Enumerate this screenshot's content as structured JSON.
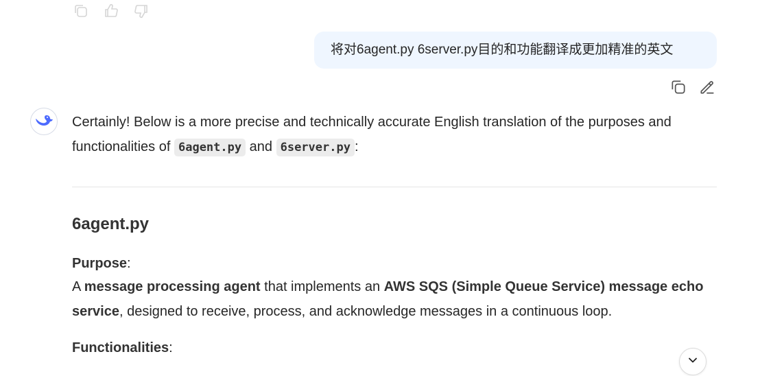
{
  "top_actions": {
    "icons": [
      "copy-icon",
      "thumbs-up-icon",
      "thumbs-down-icon"
    ]
  },
  "user_message": {
    "text": "将对6agent.py 6server.py目的和功能翻译成更加精准的英文",
    "actions": [
      "copy-icon",
      "edit-icon"
    ]
  },
  "assistant": {
    "avatar_icon": "whale-logo-icon",
    "intro": {
      "part1": "Certainly! Below is a more precise and technically accurate English translation of the purposes and functionalities of ",
      "code1": "6agent.py",
      "and": " and ",
      "code2": "6server.py",
      "end": ":"
    },
    "section_title": "6agent.py",
    "purpose_label": "Purpose",
    "purpose_colon": ":",
    "purpose": {
      "t1": "A ",
      "b1": "message processing agent",
      "t2": " that implements an ",
      "b2": "AWS SQS (Simple Queue Service) message echo service",
      "t3": ", designed to receive, process, and acknowledge messages in a continuous loop."
    },
    "functionalities_label": "Functionalities",
    "functionalities_colon": ":"
  },
  "scroll_button_icon": "chevron-down-icon",
  "colors": {
    "bubble_bg": "#eff6ff",
    "brand": "#4d6bfe",
    "text": "#262626"
  }
}
